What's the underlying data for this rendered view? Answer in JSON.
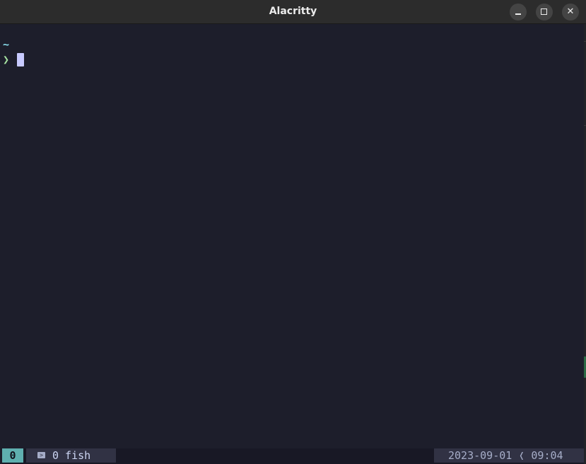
{
  "window": {
    "title": "Alacritty",
    "minimize_glyph": "_",
    "close_glyph": "✕"
  },
  "terminal": {
    "cwd": "~",
    "prompt_symbol": "❯",
    "input": ""
  },
  "statusbar": {
    "session": "0",
    "window_icon": "terminal-icon",
    "window_label": "0 fish",
    "datetime": "2023-09-01 ❬ 09:04"
  },
  "colors": {
    "terminal_bg": "#1d1e2b",
    "cwd": "#89dceb",
    "prompt": "#a6e3a1",
    "cursor": "#c8caff",
    "session_bg": "#5fafaf",
    "status_bg": "#181825",
    "tab_bg": "#313244"
  }
}
